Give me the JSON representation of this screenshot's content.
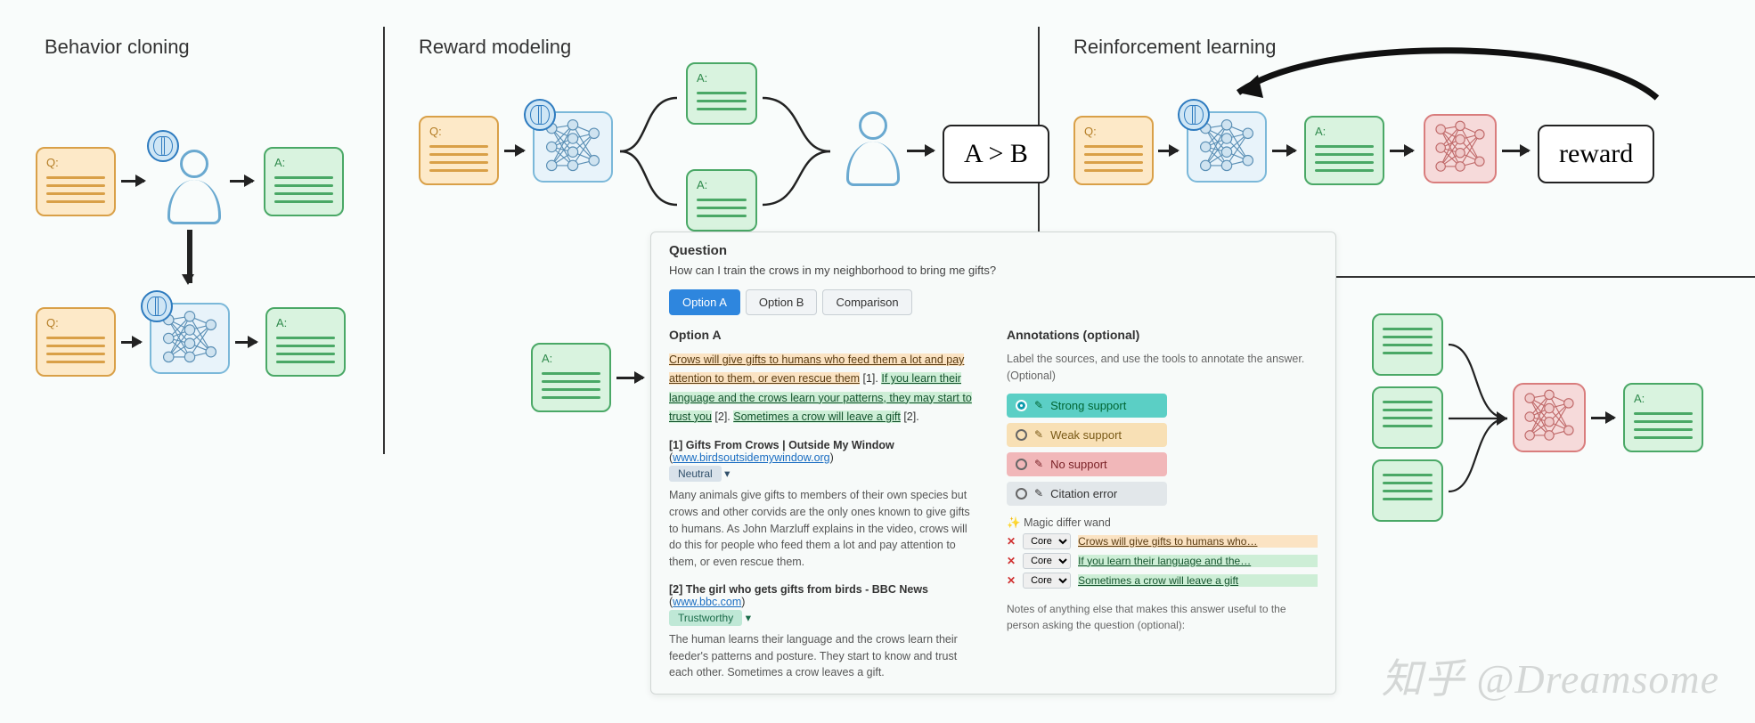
{
  "panels": {
    "bc": "Behavior cloning",
    "rm": "Reward modeling",
    "rl": "Reinforcement learning"
  },
  "doc": {
    "q": "Q:",
    "a": "A:"
  },
  "pref": "A > B",
  "reward": "reward",
  "ui": {
    "question_heading": "Question",
    "question_text": "How can I train the crows in my neighborhood to bring me gifts?",
    "tabs": {
      "a": "Option A",
      "b": "Option B",
      "c": "Comparison"
    },
    "option_heading": "Option A",
    "ann_heading": "Annotations (optional)",
    "ann_note": "Label the sources, and use the tools to annotate the answer. (Optional)",
    "ans": {
      "s1": "Crows will give gifts to humans who feed them a lot and pay attention to them, or even rescue them",
      "c1": " [1]. ",
      "s2": "If you learn their language and the crows learn your patterns, they may start to trust you",
      "c2": " [2]. ",
      "s3": "Sometimes a crow will leave a gift",
      "c3": " [2]."
    },
    "src1": {
      "title": "[1] Gifts From Crows | Outside My Window",
      "url": "www.birdsoutsidemywindow.org",
      "badge": "Neutral",
      "body": "Many animals give gifts to members of their own species but crows and other corvids are the only ones known to give gifts to humans. As John Marzluff explains in the video, crows will do this for people who feed them a lot and pay attention to them, or even rescue them."
    },
    "src2": {
      "title": "[2] The girl who gets gifts from birds - BBC News",
      "url": "www.bbc.com",
      "badge": "Trustworthy",
      "body": "The human learns their language and the crows learn their feeder's patterns and posture. They start to know and trust each other. Sometimes a crow leaves a gift."
    },
    "buttons": {
      "strong": "Strong support",
      "weak": "Weak support",
      "none": "No support",
      "err": "Citation error"
    },
    "wand": "Magic differ wand",
    "core": "Core",
    "snips": {
      "a": "Crows will give gifts to humans who…",
      "b": "If you learn their language and the…",
      "c": "Sometimes a crow will leave a gift"
    },
    "notes": "Notes of anything else that makes this answer useful to the person asking the question (optional):"
  },
  "watermark": "知乎 @Dreamsome"
}
